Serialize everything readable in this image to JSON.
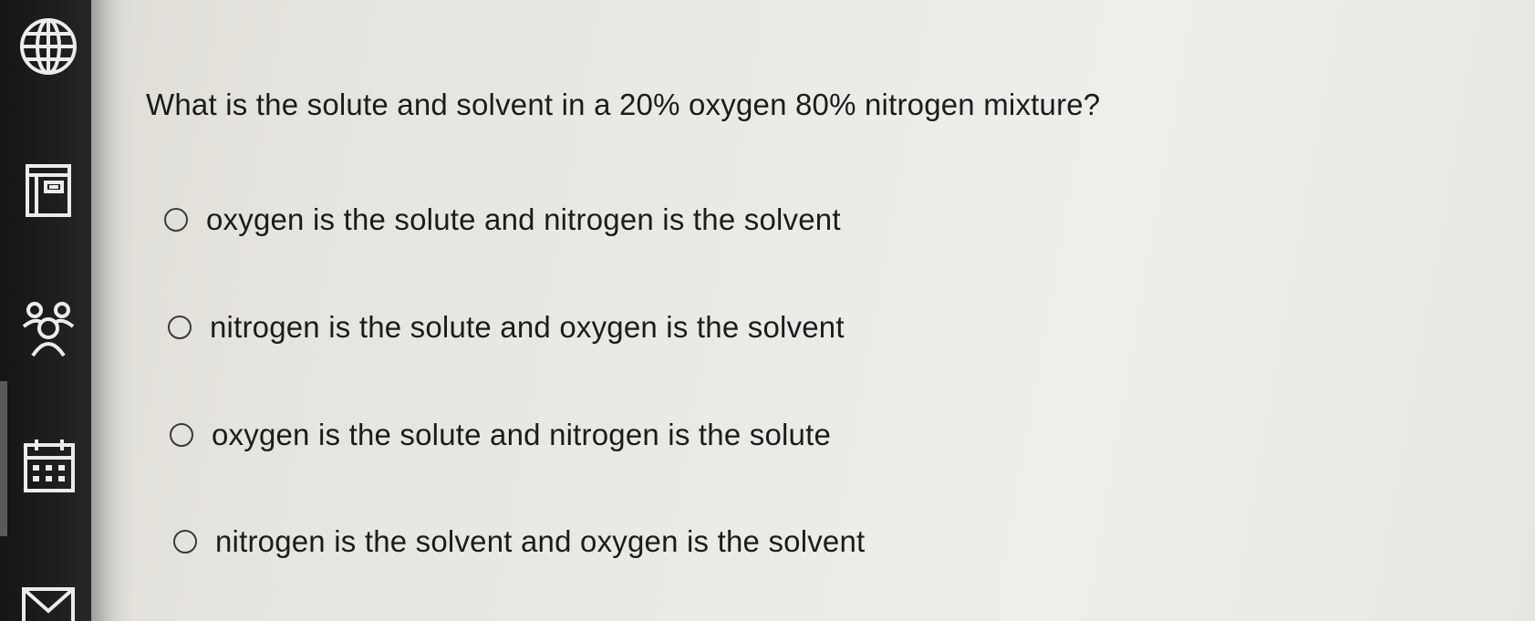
{
  "sidebar": {
    "icons": [
      "globe-icon",
      "book-icon",
      "people-icon",
      "calendar-icon",
      "mail-icon"
    ]
  },
  "question": {
    "text": "What is the solute and solvent in a 20% oxygen 80% nitrogen mixture?"
  },
  "options": [
    {
      "label": "oxygen is the solute and nitrogen is the solvent",
      "selected": false
    },
    {
      "label": "nitrogen is the solute and oxygen is the solvent",
      "selected": false
    },
    {
      "label": "oxygen is the solute and nitrogen is the solute",
      "selected": false
    },
    {
      "label": "nitrogen is the solvent and oxygen is the solvent",
      "selected": false
    }
  ]
}
